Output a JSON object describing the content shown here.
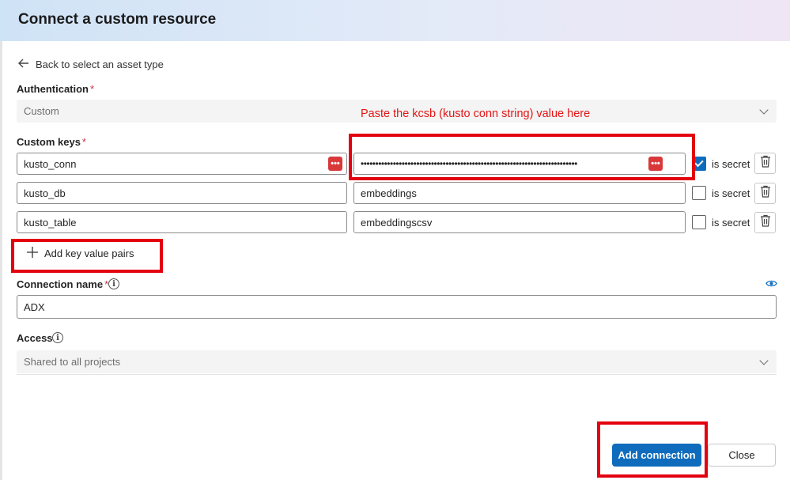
{
  "dialog": {
    "title": "Connect a custom resource"
  },
  "back_link": {
    "label": "Back to select an asset type"
  },
  "authentication": {
    "label": "Authentication",
    "required_mark": "*",
    "value": "Custom"
  },
  "annotation": {
    "text": "Paste the kcsb (kusto conn string) value here"
  },
  "custom_keys": {
    "label": "Custom keys",
    "required_mark": "*",
    "rows": [
      {
        "key": "kusto_conn",
        "value": "••••••••••••••••••••••••••••••••••••••••••••••••••••••••••••••••••••••••••",
        "masked": true,
        "is_secret": true,
        "secret_label": "is secret"
      },
      {
        "key": "kusto_db",
        "value": "embeddings",
        "masked": false,
        "is_secret": false,
        "secret_label": "is secret"
      },
      {
        "key": "kusto_table",
        "value": "embeddingscsv",
        "masked": false,
        "is_secret": false,
        "secret_label": "is secret"
      }
    ],
    "add_label": "Add key value pairs"
  },
  "connection_name": {
    "label": "Connection name",
    "required_mark": "*",
    "value": "ADX"
  },
  "access": {
    "label": "Access",
    "value": "Shared to all projects"
  },
  "buttons": {
    "primary": "Add connection",
    "secondary": "Close"
  },
  "colors": {
    "accent": "#0f6cbd",
    "annotation": "#e51515",
    "highlight_box": "#e3000f",
    "password_icon": "#d9383a"
  },
  "icons": {
    "back": "arrow-left-icon",
    "chevron": "chevron-down-icon",
    "password": "password-dots-icon",
    "delete": "trash-icon",
    "add": "plus-icon",
    "info": "info-icon",
    "visibility": "eye-icon"
  }
}
